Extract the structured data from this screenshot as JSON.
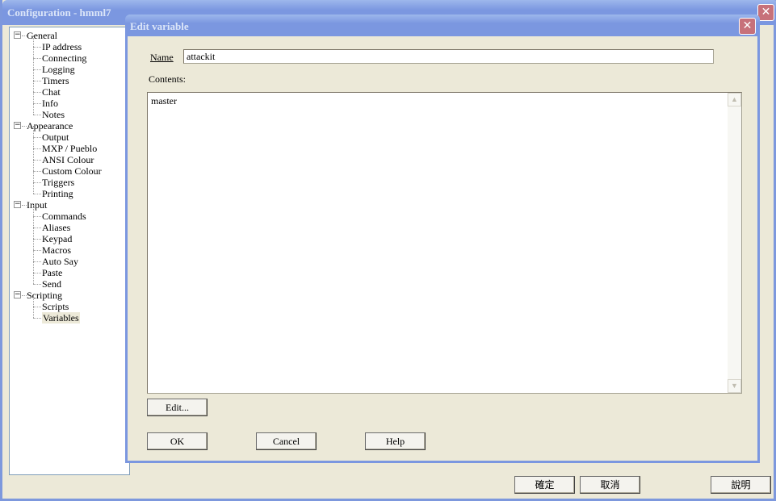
{
  "window": {
    "title": "Configuration - hmml7"
  },
  "tree": [
    {
      "label": "General",
      "level": 0
    },
    {
      "label": "IP address",
      "level": 1
    },
    {
      "label": "Connecting",
      "level": 1
    },
    {
      "label": "Logging",
      "level": 1
    },
    {
      "label": "Timers",
      "level": 1
    },
    {
      "label": "Chat",
      "level": 1
    },
    {
      "label": "Info",
      "level": 1
    },
    {
      "label": "Notes",
      "level": 1
    },
    {
      "label": "Appearance",
      "level": 0
    },
    {
      "label": "Output",
      "level": 1
    },
    {
      "label": "MXP / Pueblo",
      "level": 1
    },
    {
      "label": "ANSI Colour",
      "level": 1
    },
    {
      "label": "Custom Colour",
      "level": 1
    },
    {
      "label": "Triggers",
      "level": 1
    },
    {
      "label": "Printing",
      "level": 1
    },
    {
      "label": "Input",
      "level": 0
    },
    {
      "label": "Commands",
      "level": 1
    },
    {
      "label": "Aliases",
      "level": 1
    },
    {
      "label": "Keypad",
      "level": 1
    },
    {
      "label": "Macros",
      "level": 1
    },
    {
      "label": "Auto Say",
      "level": 1
    },
    {
      "label": "Paste",
      "level": 1
    },
    {
      "label": "Send",
      "level": 1
    },
    {
      "label": "Scripting",
      "level": 0
    },
    {
      "label": "Scripts",
      "level": 1
    },
    {
      "label": "Variables",
      "level": 1,
      "selected": true
    }
  ],
  "dialog": {
    "title": "Edit variable",
    "name_label": "Name",
    "name_value": "attackit",
    "contents_label": "Contents:",
    "contents_value": "master",
    "edit_button": "Edit...",
    "ok_button": "OK",
    "cancel_button": "Cancel",
    "help_button": "Help"
  },
  "footer": {
    "ok": "確定",
    "cancel": "取消",
    "help": "說明"
  }
}
